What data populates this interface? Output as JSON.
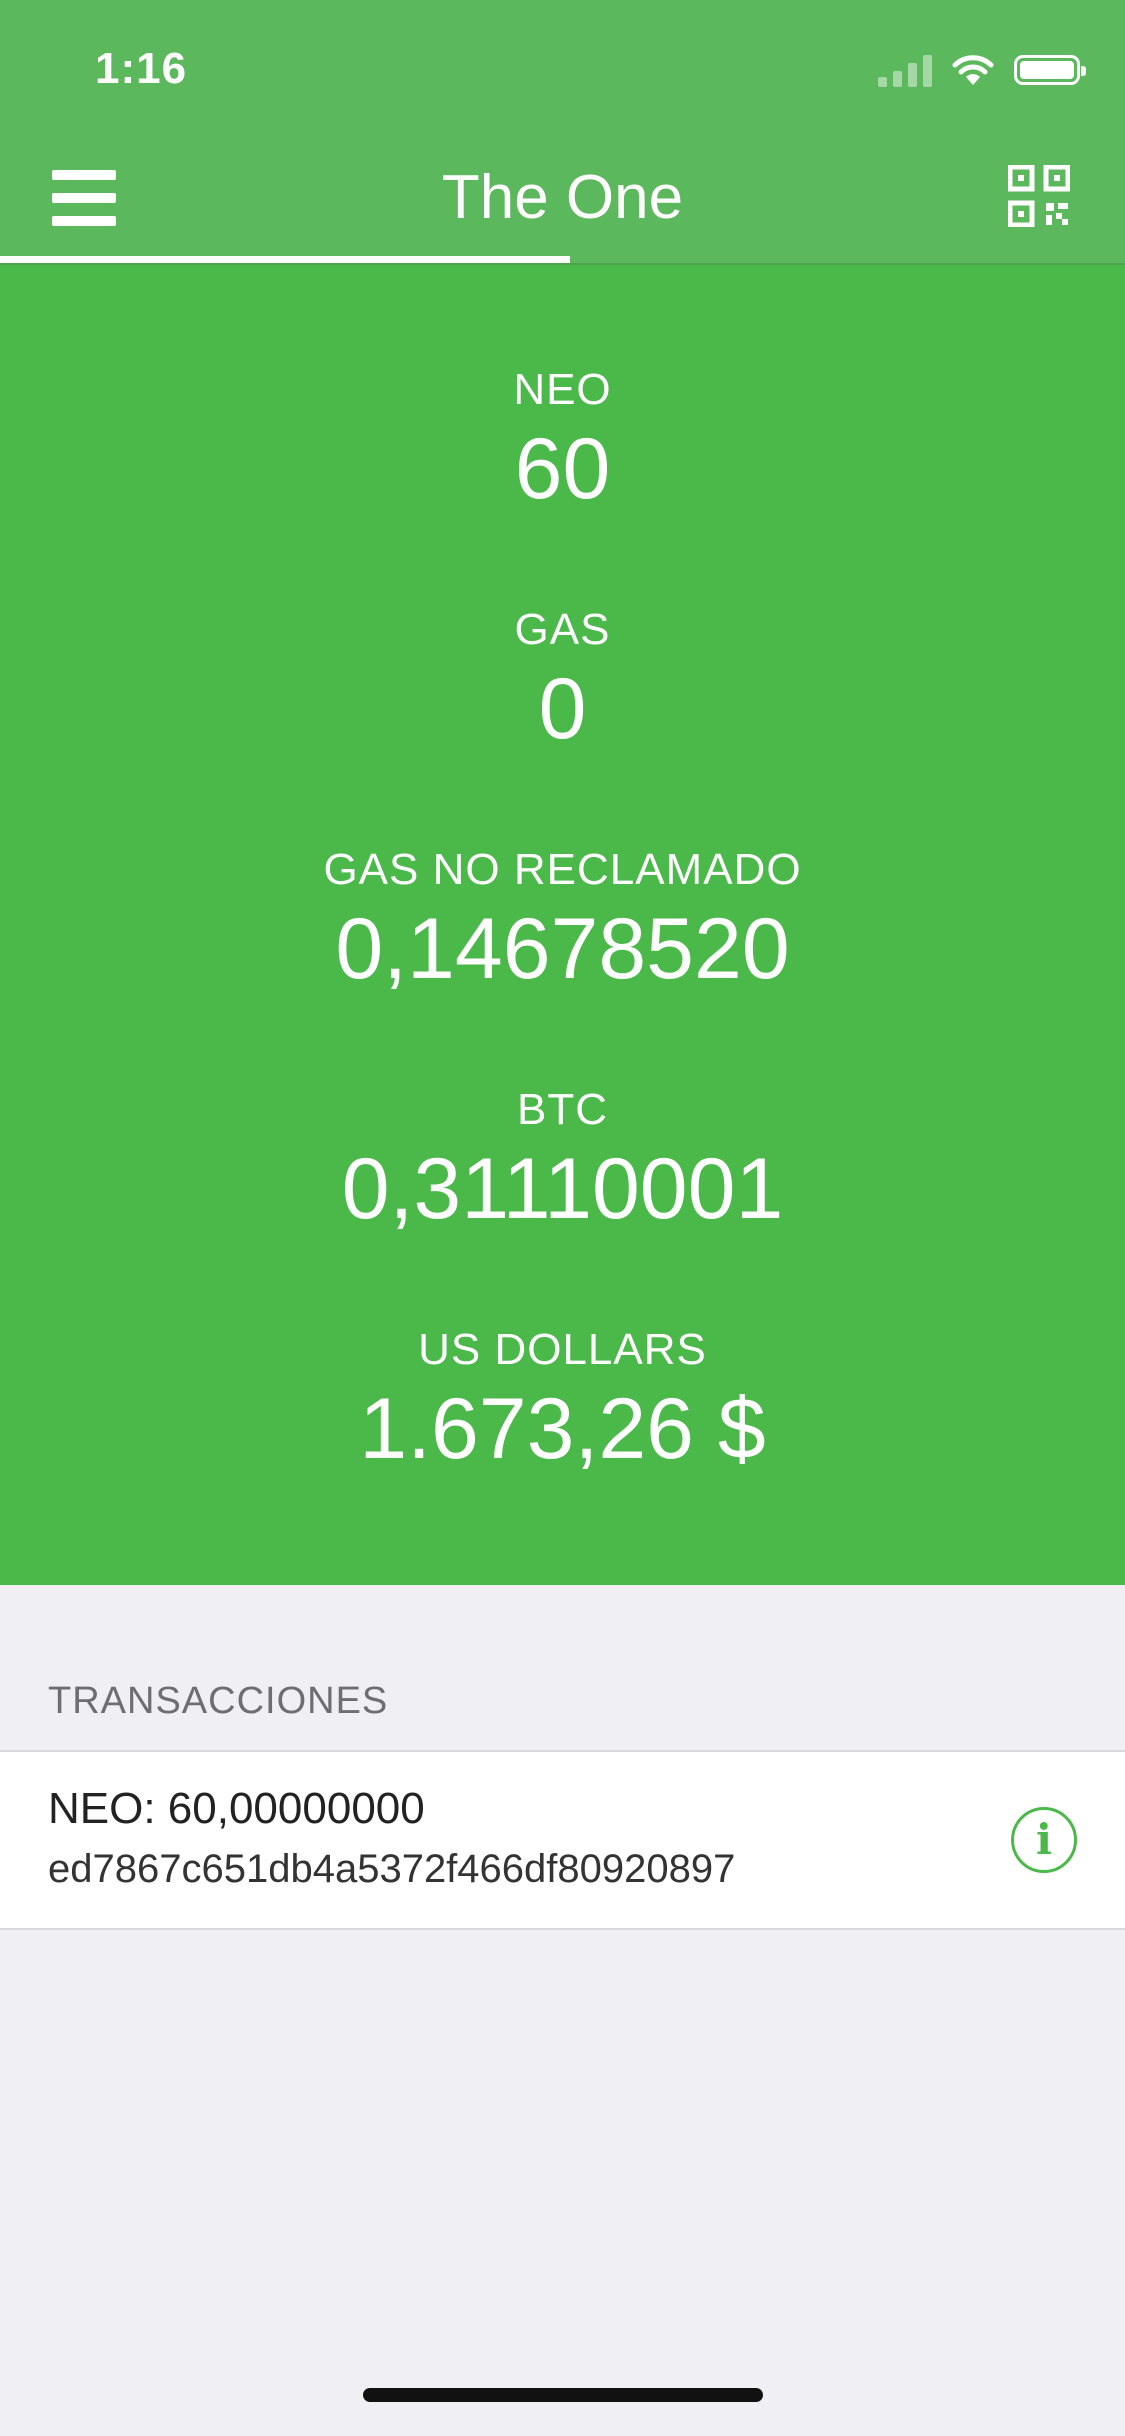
{
  "status_bar": {
    "time": "1:16",
    "icons": [
      "signal-icon",
      "wifi-icon",
      "battery-icon"
    ]
  },
  "nav": {
    "title": "The One",
    "left_icon": "menu-icon",
    "right_icon": "qr-code-icon"
  },
  "balances": [
    {
      "label": "NEO",
      "value": "60"
    },
    {
      "label": "GAS",
      "value": "0"
    },
    {
      "label": "GAS NO RECLAMADO",
      "value": "0,14678520"
    },
    {
      "label": "BTC",
      "value": "0,31110001"
    },
    {
      "label": "US DOLLARS",
      "value": "1.673,26 $"
    }
  ],
  "transactions": {
    "header": "TRANSACCIONES",
    "items": [
      {
        "amount": "NEO: 60,00000000",
        "txid": "ed7867c651db4a5372f466df80920897",
        "info_glyph": "i"
      }
    ]
  },
  "colors": {
    "header_green": "#5cb85c",
    "balance_green": "#4bb84a",
    "background": "#efeff4"
  }
}
